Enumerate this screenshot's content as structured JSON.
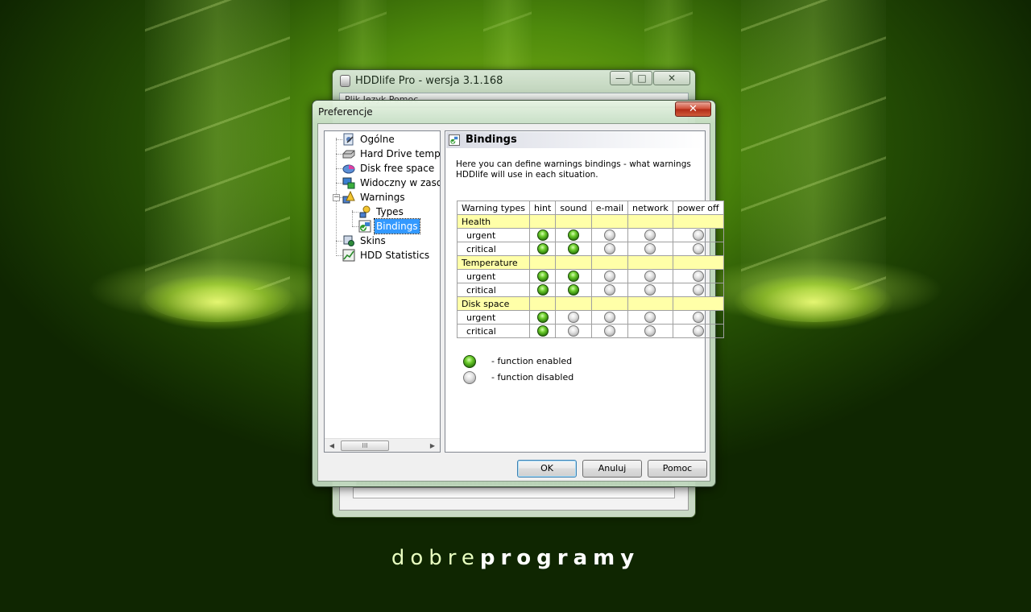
{
  "background_brand": {
    "part1": "dobre",
    "part2": "programy"
  },
  "main_window": {
    "title": "HDDlife Pro - wersja 3.1.168",
    "menu_text": "Plik   Język   Pomoc",
    "minimize_glyph": "—",
    "maximize_glyph": "□",
    "close_glyph": "✕"
  },
  "dialog": {
    "title": "Preferencje",
    "close_glyph": "✕",
    "tree": {
      "items": [
        {
          "label": "Ogólne",
          "icon": "settings-icon"
        },
        {
          "label": "Hard Drive temper",
          "icon": "drive-icon"
        },
        {
          "label": "Disk free space",
          "icon": "pie-chart-icon"
        },
        {
          "label": "Widoczny w zasob",
          "icon": "monitor-icon"
        },
        {
          "label": "Warnings",
          "icon": "warnings-icon",
          "expander": "−"
        },
        {
          "label": "Types",
          "icon": "types-icon"
        },
        {
          "label": "Bindings",
          "icon": "bindings-icon",
          "selected": true
        },
        {
          "label": "Skins",
          "icon": "skins-icon"
        },
        {
          "label": "HDD Statistics",
          "icon": "statistics-icon"
        }
      ],
      "scroll_left": "◀",
      "scroll_right": "▶",
      "scroll_thumb": "III"
    },
    "panel": {
      "heading": "Bindings",
      "description": "Here you can define warnings bindings - what warnings HDDlife will use in each situation.",
      "table": {
        "headers": [
          "Warning types",
          "hint",
          "sound",
          "e-mail",
          "network",
          "power off"
        ],
        "groups": [
          {
            "name": "Health",
            "rows": [
              {
                "label": "urgent",
                "states": [
                  true,
                  true,
                  false,
                  false,
                  false
                ]
              },
              {
                "label": "critical",
                "states": [
                  true,
                  true,
                  false,
                  false,
                  false
                ]
              }
            ]
          },
          {
            "name": "Temperature",
            "rows": [
              {
                "label": "urgent",
                "states": [
                  true,
                  true,
                  false,
                  false,
                  false
                ]
              },
              {
                "label": "critical",
                "states": [
                  true,
                  true,
                  false,
                  false,
                  false
                ]
              }
            ]
          },
          {
            "name": "Disk space",
            "rows": [
              {
                "label": "urgent",
                "states": [
                  true,
                  false,
                  false,
                  false,
                  false
                ]
              },
              {
                "label": "critical",
                "states": [
                  true,
                  false,
                  false,
                  false,
                  false
                ]
              }
            ]
          }
        ]
      },
      "legend": {
        "enabled": "- function enabled",
        "disabled": "- function disabled"
      }
    },
    "buttons": {
      "ok": "OK",
      "cancel": "Anuluj",
      "help": "Pomoc"
    }
  },
  "colors": {
    "group_row": "#ffffa8",
    "selection": "#3399ff",
    "led_on": "#4ca81a",
    "led_off": "#c8c8c8"
  }
}
